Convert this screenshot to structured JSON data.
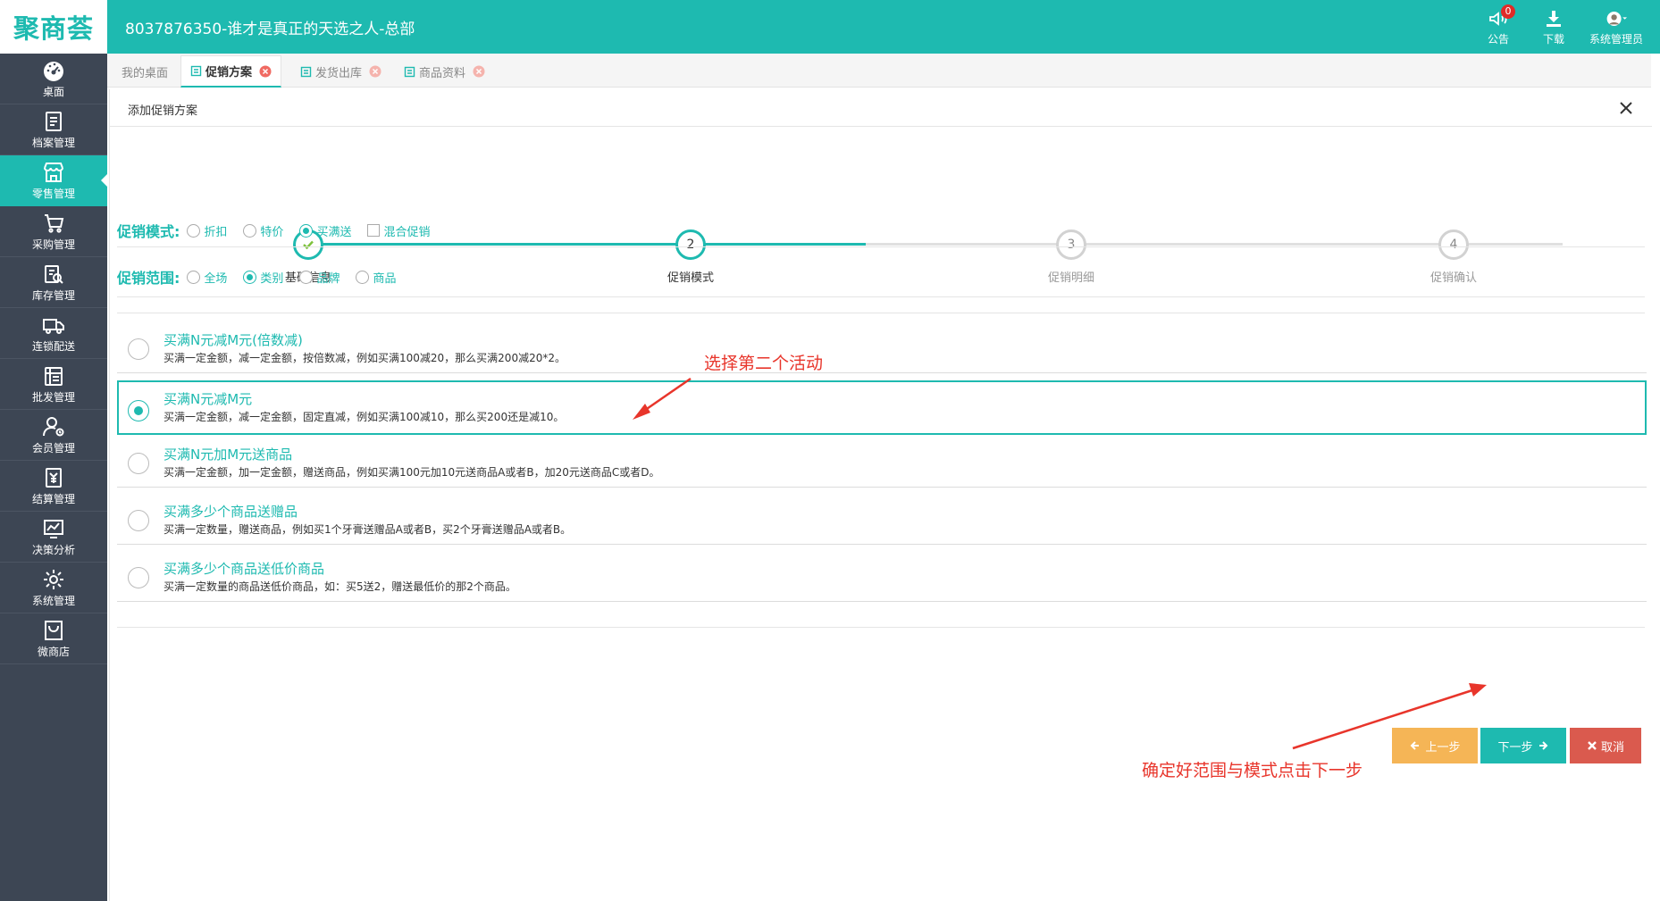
{
  "header": {
    "logo": "聚商荟",
    "title": "8037876350-谁才是真正的天选之人-总部",
    "actions": [
      {
        "label": "公告",
        "icon": "announcement-icon",
        "badge": "0"
      },
      {
        "label": "下载",
        "icon": "download-icon"
      },
      {
        "label": "系统管理员",
        "icon": "user-avatar-icon"
      }
    ]
  },
  "sidebar": {
    "items": [
      {
        "label": "桌面",
        "icon": "dashboard-icon"
      },
      {
        "label": "档案管理",
        "icon": "archive-icon"
      },
      {
        "label": "零售管理",
        "icon": "store-icon",
        "active": true
      },
      {
        "label": "采购管理",
        "icon": "cart-icon"
      },
      {
        "label": "库存管理",
        "icon": "inventory-icon"
      },
      {
        "label": "连锁配送",
        "icon": "truck-icon"
      },
      {
        "label": "批发管理",
        "icon": "wholesale-icon"
      },
      {
        "label": "会员管理",
        "icon": "member-icon"
      },
      {
        "label": "结算管理",
        "icon": "settlement-icon"
      },
      {
        "label": "决策分析",
        "icon": "analytics-icon"
      },
      {
        "label": "系统管理",
        "icon": "settings-icon"
      },
      {
        "label": "微商店",
        "icon": "micro-store-icon"
      }
    ]
  },
  "tabs": [
    {
      "label": "我的桌面"
    },
    {
      "label": "促销方案",
      "active": true
    },
    {
      "label": "发货出库"
    },
    {
      "label": "商品资料"
    }
  ],
  "panel": {
    "title": "添加促销方案"
  },
  "steps": [
    {
      "number": "1",
      "label": "基础信息",
      "state": "done"
    },
    {
      "number": "2",
      "label": "促销模式",
      "state": "current"
    },
    {
      "number": "3",
      "label": "促销明细",
      "state": "pending"
    },
    {
      "number": "4",
      "label": "促销确认",
      "state": "pending"
    }
  ],
  "mode": {
    "label": "促销模式:",
    "options": [
      "折扣",
      "特价",
      "买满送"
    ],
    "selected": "买满送",
    "mixed_label": "混合促销",
    "mixed_checked": false
  },
  "scope": {
    "label": "促销范围:",
    "options": [
      "全场",
      "类别",
      "品牌",
      "商品"
    ],
    "selected": "类别"
  },
  "activities": [
    {
      "title": "买满N元减M元(倍数减)",
      "desc": "买满一定金额，减一定金额，按倍数减，例如买满100减20，那么买满200减20*2。",
      "selected": false
    },
    {
      "title": "买满N元减M元",
      "desc": "买满一定金额，减一定金额，固定直减，例如买满100减10，那么买200还是减10。",
      "selected": true
    },
    {
      "title": "买满N元加M元送商品",
      "desc": "买满一定金额，加一定金额，赠送商品，例如买满100元加10元送商品A或者B，加20元送商品C或者D。",
      "selected": false
    },
    {
      "title": "买满多少个商品送赠品",
      "desc": "买满一定数量，赠送商品，例如买1个牙膏送赠品A或者B，买2个牙膏送赠品A或者B。",
      "selected": false
    },
    {
      "title": "买满多少个商品送低价商品",
      "desc": "买满一定数量的商品送低价商品，如：买5送2，赠送最低价的那2个商品。",
      "selected": false
    }
  ],
  "buttons": {
    "prev": "上一步",
    "next": "下一步",
    "cancel": "取消"
  },
  "annotations": {
    "pick_second": "选择第二个活动",
    "click_next": "确定好范围与模式点击下一步"
  },
  "colors": {
    "primary": "#1ebab0",
    "sidebar": "#3d4654",
    "prev_button": "#f5b556",
    "cancel_button": "#da5a4e",
    "annotation": "#e8352b"
  }
}
